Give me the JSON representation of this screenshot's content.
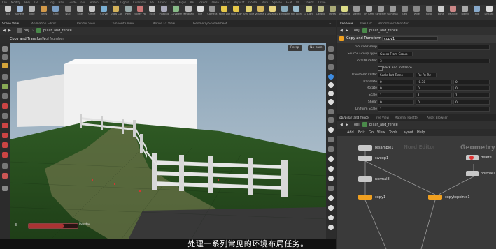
{
  "shelf": {
    "tabs": [
      "Cre",
      "Modify",
      "Poly",
      "De",
      "Te",
      "Rig",
      "Hair",
      "Guide",
      "Gu",
      "Terrain",
      "Sim",
      "Vol",
      "Lights",
      "Collisions",
      "Pa",
      "Grains",
      "Ve",
      "Rigid",
      "Par",
      "Viscos",
      "Ocea",
      "Fluid",
      "Populat",
      "Contai",
      "Pyro",
      "Sparse",
      "FEM",
      "Wi",
      "Crowds",
      "Drive"
    ],
    "tools": [
      {
        "label": "Box",
        "icon": "box-icon",
        "color": "#c9c9c9"
      },
      {
        "label": "Sphere",
        "icon": "sphere-icon",
        "color": "#9fb8d6"
      },
      {
        "label": "Tube",
        "icon": "tube-icon",
        "color": "#b5b5b5"
      },
      {
        "label": "Torus",
        "icon": "torus-icon",
        "color": "#d39a4a"
      },
      {
        "label": "Grid",
        "icon": "grid-icon",
        "color": "#7a9ec4"
      },
      {
        "label": "Null",
        "icon": "null-icon",
        "color": "#8d8d8d"
      },
      {
        "label": "Line",
        "icon": "line-icon",
        "color": "#b0b0b0"
      },
      {
        "label": "Circle",
        "icon": "circle-icon",
        "color": "#c9c9c9"
      },
      {
        "label": "Curve",
        "icon": "curve-icon",
        "color": "#7bb0d4"
      },
      {
        "label": "Draw Curve",
        "icon": "pen-icon",
        "color": "#d4b25a"
      },
      {
        "label": "Path",
        "icon": "path-icon",
        "color": "#9aa"
      },
      {
        "label": "Spray Paint",
        "icon": "spray-icon",
        "color": "#c77"
      },
      {
        "label": "Font",
        "icon": "font-icon",
        "color": "#ccc"
      },
      {
        "label": "Platonic",
        "icon": "platonic-icon",
        "color": "#aab"
      },
      {
        "label": "L-System",
        "icon": "lsystem-icon",
        "color": "#8b8"
      },
      {
        "label": "Metaball",
        "icon": "metaball-icon",
        "color": "#bbb"
      },
      {
        "label": "File",
        "icon": "file-icon",
        "color": "#ddd"
      },
      {
        "label": "Camera",
        "icon": "camera-icon",
        "color": "#999"
      },
      {
        "label": "Point Light",
        "icon": "pointlight-icon",
        "color": "#e6c84a"
      },
      {
        "label": "Spot Light",
        "icon": "spotlight-icon",
        "color": "#e6c84a"
      },
      {
        "label": "Area Light",
        "icon": "arealight-icon",
        "color": "#e0d070"
      },
      {
        "label": "Volume Light",
        "icon": "volumelight-icon",
        "color": "#d6b860"
      },
      {
        "label": "Distant Light",
        "icon": "distantlight-icon",
        "color": "#e8d480"
      },
      {
        "label": "Environment",
        "icon": "envlight-icon",
        "color": "#8ab"
      },
      {
        "label": "Sky Light",
        "icon": "skylight-icon",
        "color": "#9bc"
      },
      {
        "label": "GI Light",
        "icon": "gilight-icon",
        "color": "#cc8"
      },
      {
        "label": "Caustic",
        "icon": "caustic-icon",
        "color": "#bb8"
      },
      {
        "label": "Portal",
        "icon": "portal-icon",
        "color": "#aa7"
      },
      {
        "label": "Ambient",
        "icon": "ambient-icon",
        "color": "#dd8"
      },
      {
        "label": "Stereo",
        "icon": "stereo-icon",
        "color": "#999"
      },
      {
        "label": "VR Cam",
        "icon": "vrcam-icon",
        "color": "#aaa"
      },
      {
        "label": "Switcher",
        "icon": "switcher-icon",
        "color": "#999"
      },
      {
        "label": "Gamepad",
        "icon": "gamepad-icon",
        "color": "#999"
      },
      {
        "label": "Geo",
        "icon": "geo-icon",
        "color": "#888"
      },
      {
        "label": "Wire",
        "icon": "wire-icon",
        "color": "#888"
      },
      {
        "label": "Roto",
        "icon": "roto-icon",
        "color": "#888"
      },
      {
        "label": "Bone",
        "icon": "bone-icon",
        "color": "#ccc"
      },
      {
        "label": "Muscle",
        "icon": "muscle-icon",
        "color": "#c88"
      },
      {
        "label": "Blend",
        "icon": "blend-icon",
        "color": "#aaa"
      },
      {
        "label": "Flip",
        "icon": "flip-icon",
        "color": "#8ac"
      },
      {
        "label": "Distant",
        "icon": "distant-icon",
        "color": "#ddd"
      }
    ]
  },
  "left_pane": {
    "tabs": [
      "Scene View",
      "Animation Editor",
      "Render View",
      "Composite View",
      "Motion FX View",
      "Geometry Spreadsheet"
    ],
    "path": "obj",
    "path_node": "pillar_and_fence",
    "viewport_title": "Copy and Transform",
    "viewport_subtitle": "Tool Number",
    "persp_label": "Persp",
    "cam_label": "No cam",
    "slider_label": "Render",
    "frame_value": "3"
  },
  "right_pane": {
    "tabs": [
      "Tree View",
      "Take List",
      "Performance Monitor"
    ],
    "path": "obj",
    "path_node": "pillar_and_fence",
    "node_type": "Copy and Transform",
    "node_name": "copy1",
    "params": [
      {
        "label": "Source Group",
        "value": ""
      },
      {
        "label": "Source Group Type",
        "value": "Guess From Group"
      },
      {
        "label": "Total Number",
        "value": "3"
      },
      {
        "label": "",
        "value": "Pack and Instance"
      },
      {
        "label": "Transform Order",
        "value": "Scale Rot Trans",
        "value2": "Rx Ry Rz"
      },
      {
        "label": "Translate",
        "value": "0",
        "value2": "-0.38",
        "value3": "0"
      },
      {
        "label": "Rotate",
        "value": "0",
        "value2": "0",
        "value3": "0"
      },
      {
        "label": "Scale",
        "value": "1",
        "value2": "1",
        "value3": "1"
      },
      {
        "label": "Shear",
        "value": "0",
        "value2": "0",
        "value3": "0"
      },
      {
        "label": "Uniform Scale",
        "value": "1"
      }
    ]
  },
  "network": {
    "tabs": [
      "obj/pillar_and_fence",
      "Tree View",
      "Material Palette",
      "Asset Browser"
    ],
    "path": "obj",
    "path_node": "pillar_and_fence",
    "menu": [
      "Add",
      "Edit",
      "Go",
      "View",
      "Tools",
      "Layout",
      "Help"
    ],
    "watermark_left": "Nord Editor",
    "watermark_right": "Geometry",
    "nodes": [
      {
        "name": "resample1",
        "color": "#c8c8c8"
      },
      {
        "name": "sweep1",
        "color": "#c8c8c8"
      },
      {
        "name": "delete1",
        "color": "#c8c8c8"
      },
      {
        "name": "normal1",
        "color": "#c8c8c8"
      },
      {
        "name": "normal8",
        "color": "#c8c8c8"
      },
      {
        "name": "copy1",
        "color": "#f0a020"
      },
      {
        "name": "copytopoints1",
        "color": "#f0a020"
      }
    ]
  },
  "subtitle": "处理一系列常见的环境布局任务。"
}
